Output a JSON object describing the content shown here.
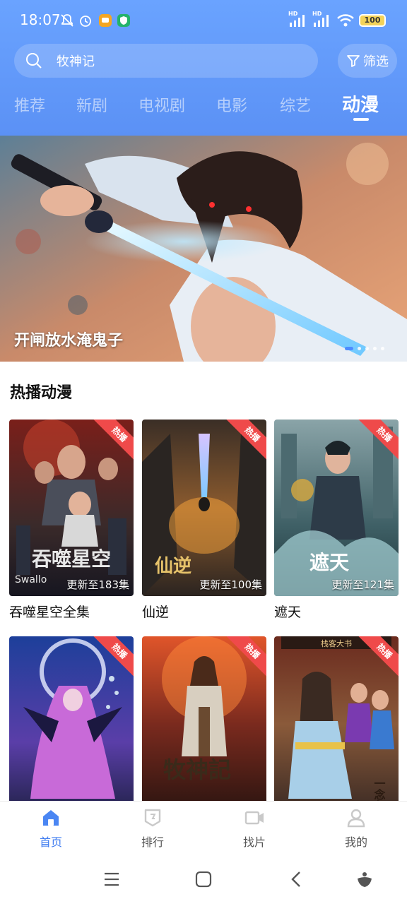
{
  "status_bar": {
    "time": "18:07",
    "signal_tag_1": "HD",
    "signal_tag_2": "HD",
    "battery": "100",
    "icons": [
      "mute-bell-icon",
      "alarm-icon",
      "message-app-icon",
      "shield-app-icon",
      "signal-icon",
      "wifi-icon",
      "battery-icon"
    ]
  },
  "search": {
    "query": "牧神记",
    "icon": "search-icon"
  },
  "filter": {
    "label": "筛选",
    "icon": "filter-icon"
  },
  "tabs": [
    {
      "label": "推荐",
      "active": false
    },
    {
      "label": "新剧",
      "active": false
    },
    {
      "label": "电视剧",
      "active": false
    },
    {
      "label": "电影",
      "active": false
    },
    {
      "label": "综艺",
      "active": false
    },
    {
      "label": "动漫",
      "active": true
    }
  ],
  "banner": {
    "title": "开闸放水淹鬼子",
    "slide_count": 5,
    "active_slide": 1
  },
  "section": {
    "title": "热播动漫"
  },
  "cards": [
    {
      "title": "吞噬星空全集",
      "update": "更新至183集",
      "badge": "热播",
      "poster_text": "吞噬星空",
      "poster_subtext": "Swallo"
    },
    {
      "title": "仙逆",
      "update": "更新至100集",
      "badge": "热播",
      "poster_text": "仙逆"
    },
    {
      "title": "遮天",
      "update": "更新至121集",
      "badge": "热播",
      "poster_text": "遮天"
    },
    {
      "title": "",
      "update": "",
      "badge": "热播"
    },
    {
      "title": "",
      "update": "",
      "badge": "热播",
      "poster_text": "牧神記"
    },
    {
      "title": "",
      "update": "",
      "badge": "热播",
      "poster_text": "一念永恒",
      "poster_sign": "栈客大书"
    }
  ],
  "bottom_nav": [
    {
      "label": "首页",
      "icon": "home-icon",
      "active": true
    },
    {
      "label": "排行",
      "icon": "ranking-icon",
      "active": false
    },
    {
      "label": "找片",
      "icon": "video-camera-icon",
      "active": false
    },
    {
      "label": "我的",
      "icon": "user-icon",
      "active": false
    }
  ],
  "system_nav": [
    "menu-icon",
    "home-square-icon",
    "back-icon",
    "assistant-icon"
  ],
  "colors": {
    "accent": "#3f7cf0",
    "header_top": "#6aa3ff",
    "badge": "#ef4a4a"
  }
}
